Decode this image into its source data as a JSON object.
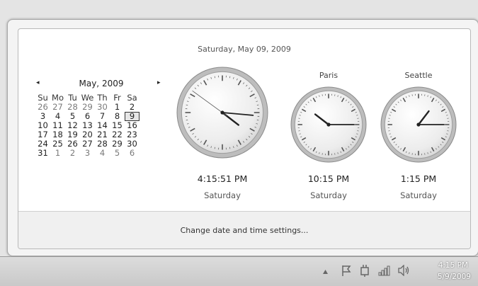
{
  "header": {
    "full_date": "Saturday, May 09, 2009"
  },
  "calendar": {
    "month_title": "May, 2009",
    "prev_glyph": "◂",
    "next_glyph": "▸",
    "weekdays": [
      "Su",
      "Mo",
      "Tu",
      "We",
      "Th",
      "Fr",
      "Sa"
    ],
    "weeks": [
      [
        "26",
        "27",
        "28",
        "29",
        "30",
        "1",
        "2"
      ],
      [
        "3",
        "4",
        "5",
        "6",
        "7",
        "8",
        "9"
      ],
      [
        "10",
        "11",
        "12",
        "13",
        "14",
        "15",
        "16"
      ],
      [
        "17",
        "18",
        "19",
        "20",
        "21",
        "22",
        "23"
      ],
      [
        "24",
        "25",
        "26",
        "27",
        "28",
        "29",
        "30"
      ],
      [
        "31",
        "1",
        "2",
        "3",
        "4",
        "5",
        "6"
      ]
    ],
    "selected_day": "9"
  },
  "clocks": [
    {
      "label": "",
      "time": "4:15:51 PM",
      "day": "Saturday",
      "hour": 16,
      "minute": 15,
      "second": 51
    },
    {
      "label": "Paris",
      "time": "10:15 PM",
      "day": "Saturday",
      "hour": 22,
      "minute": 15,
      "second": null
    },
    {
      "label": "Seattle",
      "time": "1:15 PM",
      "day": "Saturday",
      "hour": 13,
      "minute": 15,
      "second": null
    }
  ],
  "footer": {
    "change_settings_link": "Change date and time settings..."
  },
  "taskbar": {
    "tray_icons": [
      "show-hidden-icons-icon",
      "action-center-flag-icon",
      "power-plug-icon",
      "network-signal-icon",
      "volume-icon"
    ],
    "time": "4:15 PM",
    "date": "5/9/2009"
  }
}
